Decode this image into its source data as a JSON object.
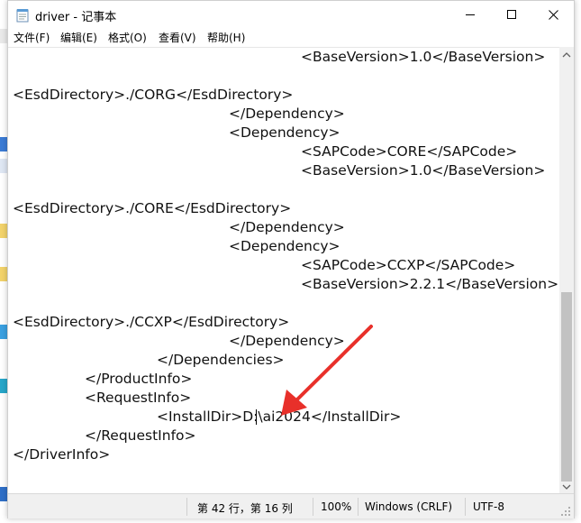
{
  "window": {
    "title": "driver - 记事本",
    "controls": {
      "minimize": "minimize-icon",
      "maximize": "maximize-icon",
      "close": "close-icon"
    }
  },
  "menu": [
    "文件(F)",
    "编辑(E)",
    "格式(O)",
    "查看(V)",
    "帮助(H)"
  ],
  "editor": {
    "lines": [
      "\t\t\t\t<BaseVersion>1.0</BaseVersion>",
      "",
      "<EsdDirectory>./CORG</EsdDirectory>",
      "\t\t\t</Dependency>",
      "\t\t\t<Dependency>",
      "\t\t\t\t<SAPCode>CORE</SAPCode>",
      "\t\t\t\t<BaseVersion>1.0</BaseVersion>",
      "",
      "<EsdDirectory>./CORE</EsdDirectory>",
      "\t\t\t</Dependency>",
      "\t\t\t<Dependency>",
      "\t\t\t\t<SAPCode>CCXP</SAPCode>",
      "\t\t\t\t<BaseVersion>2.2.1</BaseVersion>",
      "",
      "<EsdDirectory>./CCXP</EsdDirectory>",
      "\t\t\t</Dependency>",
      "\t\t</Dependencies>",
      "\t</ProductInfo>",
      "\t<RequestInfo>",
      "\t\t<InstallDir>D:\\ai2024</InstallDir>",
      "\t</RequestInfo>",
      "</DriverInfo>"
    ]
  },
  "status": {
    "position": "第 42 行，第 16 列",
    "zoom": "100%",
    "line_ending": "Windows (CRLF)",
    "encoding": "UTF-8"
  },
  "annotation": {
    "arrow_color": "#e8302a"
  }
}
